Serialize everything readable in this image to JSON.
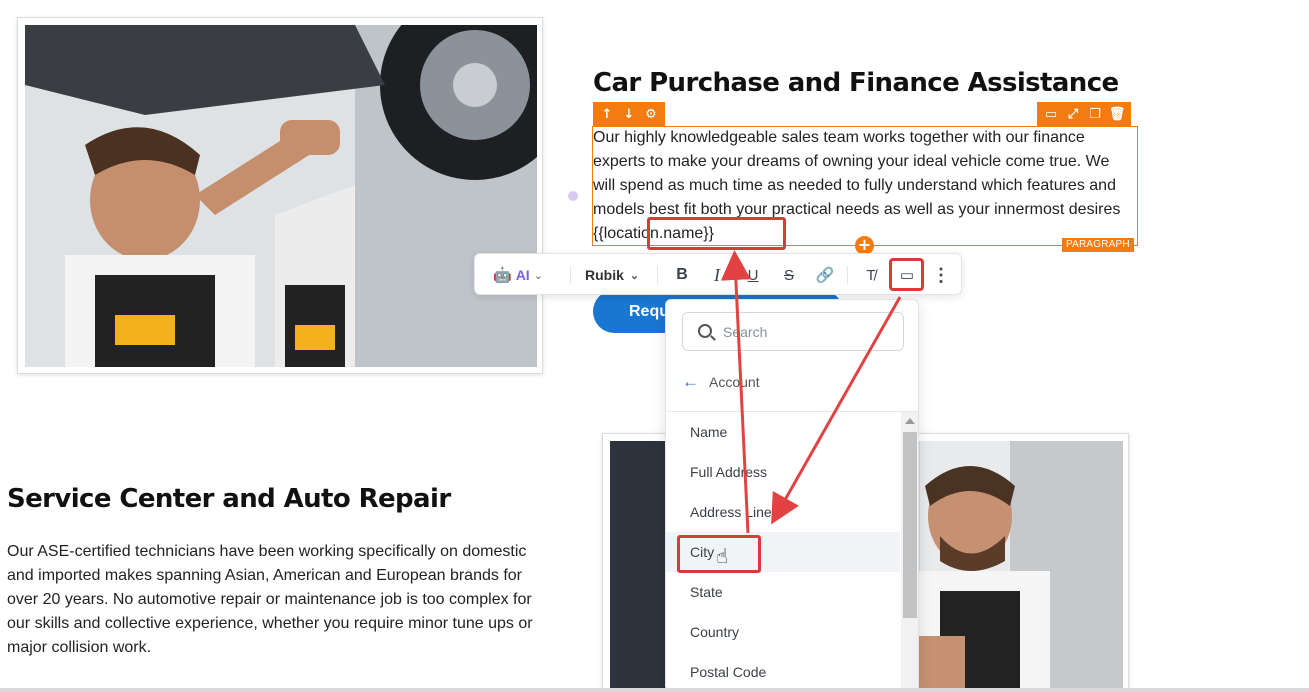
{
  "section_1": {
    "heading": "Car Purchase and Finance Assistance",
    "paragraph": "Our highly knowledgeable sales team works together with our finance experts to make your dreams of owning your ideal vehicle come true. We will spend as much time as needed to fully understand which features and models best fit both your practical needs as well as your innermost desires",
    "token": "{{location.name}}",
    "element_tag": "PARAGRAPH",
    "button_label": "Requ"
  },
  "section_2": {
    "heading": "Service Center and Auto Repair",
    "paragraph": "Our ASE-certified technicians have been working specifically on domestic and imported makes spanning Asian, American and European brands for over 20 years. No automotive repair or maintenance job is too complex for our skills and collective experience, whether you require minor tune ups or major collision work."
  },
  "toolbar": {
    "ai_label": "AI",
    "font_name": "Rubik",
    "bold": "B",
    "italic": "I",
    "underline": "U",
    "strike": "S"
  },
  "dropdown": {
    "search_placeholder": "Search",
    "back_label": "Account",
    "items": [
      "Name",
      "Full Address",
      "Address Line 1",
      "City",
      "State",
      "Country",
      "Postal Code"
    ]
  },
  "colors": {
    "accent": "#f47b10",
    "annotation": "#d93a3a",
    "button": "#1976d2",
    "ai": "#7b5cf0"
  },
  "icons": {
    "element_controls_left": [
      "arrow-up-icon",
      "arrow-down-icon",
      "gear-icon"
    ],
    "element_controls_right": [
      "desktop-icon",
      "expand-icon",
      "duplicate-icon",
      "trash-icon"
    ],
    "toolbar": [
      "ai-bot-icon",
      "link-icon",
      "clear-format-icon",
      "custom-value-icon",
      "more-icon"
    ]
  }
}
